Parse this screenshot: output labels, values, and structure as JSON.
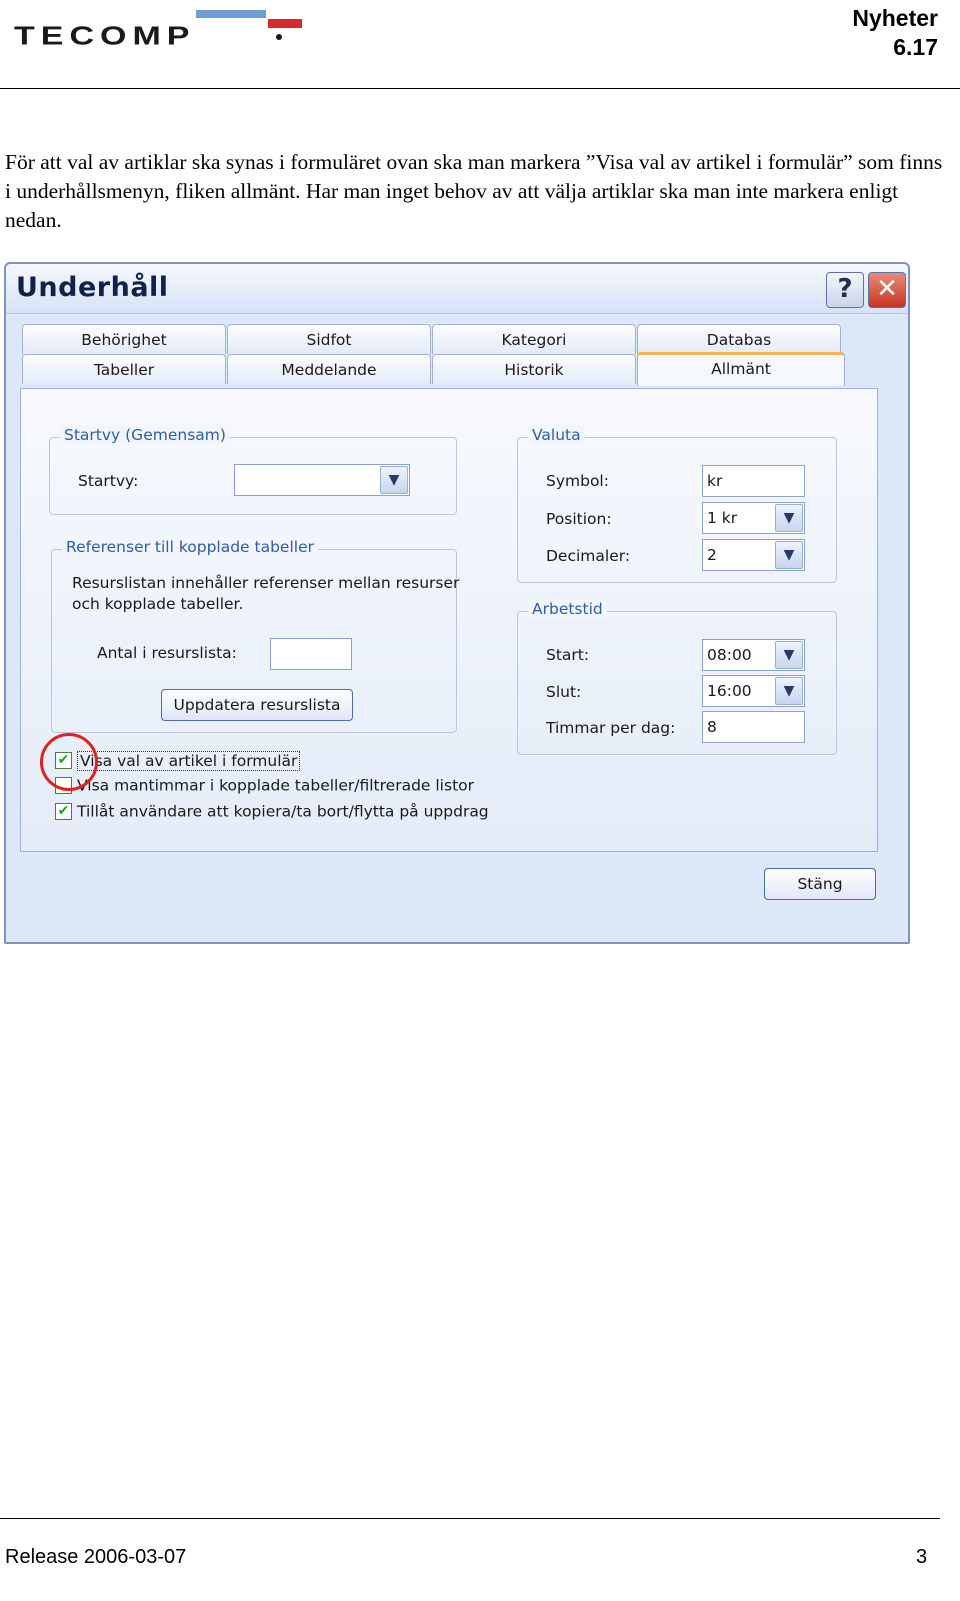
{
  "header": {
    "logo_text": "TECOMP",
    "title_line1": "Nyheter",
    "title_line2": "6.17"
  },
  "intro": "För att val av artiklar ska synas i formuläret ovan ska man markera ”Visa val av artikel i formulär” som finns i underhållsmenyn, fliken allmänt. Har man inget behov av att välja artiklar ska man inte markera enligt nedan.",
  "dialog": {
    "title": "Underhåll",
    "help_label": "?",
    "close_label": "✕",
    "tabs_row1": [
      "Behörighet",
      "Sidfot",
      "Kategori",
      "Databas"
    ],
    "tabs_row2": [
      "Tabeller",
      "Meddelande",
      "Historik",
      "Allmänt"
    ],
    "startvy": {
      "legend": "Startvy (Gemensam)",
      "label": "Startvy:",
      "value": ""
    },
    "referenser": {
      "legend": "Referenser till kopplade tabeller",
      "desc_line1": "Resurslistan innehåller referenser mellan resurser",
      "desc_line2": "och kopplade tabeller.",
      "antal_label": "Antal i resurslista:",
      "antal_value": "",
      "update_button": "Uppdatera resurslista"
    },
    "valuta": {
      "legend": "Valuta",
      "symbol_label": "Symbol:",
      "symbol_value": "kr",
      "position_label": "Position:",
      "position_value": "1 kr",
      "decimaler_label": "Decimaler:",
      "decimaler_value": "2"
    },
    "arbetstid": {
      "legend": "Arbetstid",
      "start_label": "Start:",
      "start_value": "08:00",
      "slut_label": "Slut:",
      "slut_value": "16:00",
      "timmar_label": "Timmar per dag:",
      "timmar_value": "8"
    },
    "checkboxes": [
      {
        "label": "Visa val av artikel i formulär",
        "checked": true
      },
      {
        "label": "Visa mantimmar i kopplade tabeller/filtrerade listor",
        "checked": false
      },
      {
        "label": "Tillåt användare att kopiera/ta bort/flytta på uppdrag",
        "checked": true
      }
    ],
    "close_button": "Stäng"
  },
  "footer": {
    "release": "Release 2006-03-07",
    "page": "3"
  }
}
